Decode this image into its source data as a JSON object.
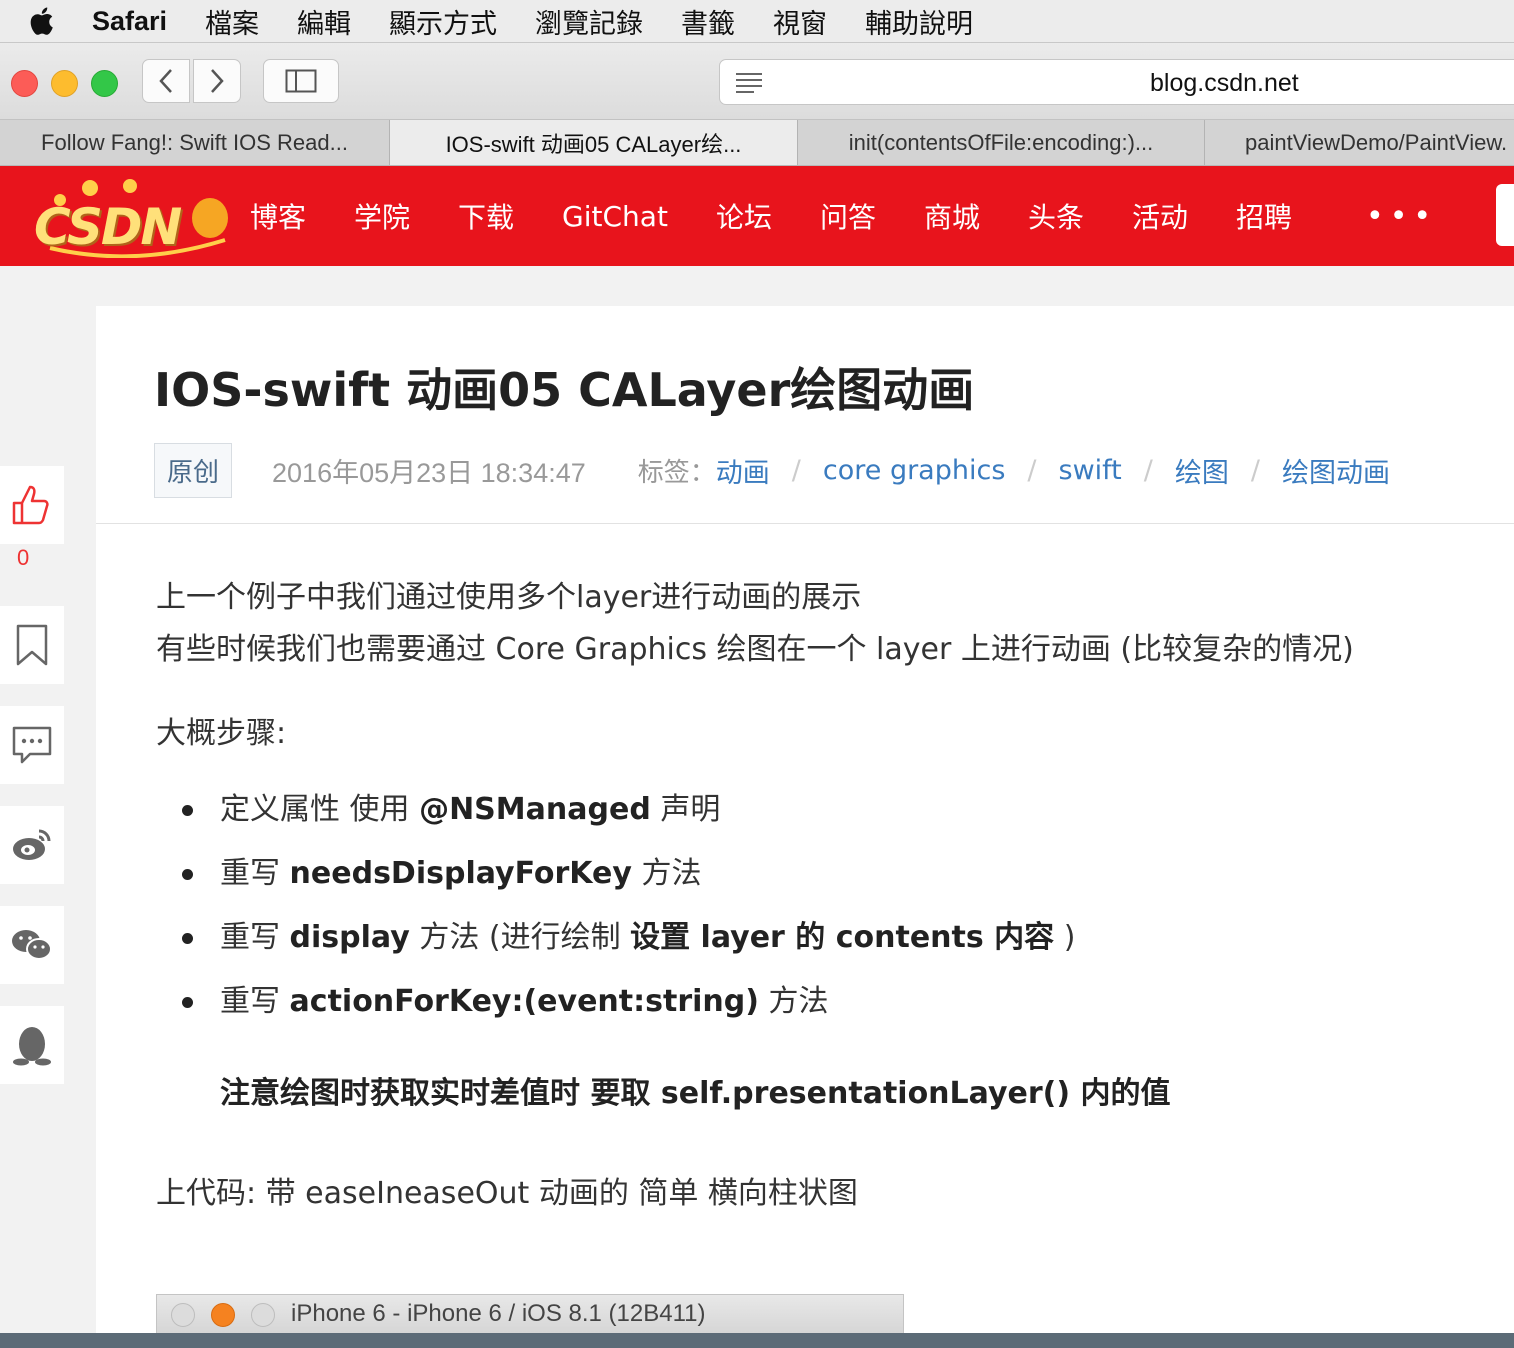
{
  "menubar": {
    "app_name": "Safari",
    "items": [
      "檔案",
      "編輯",
      "顯示方式",
      "瀏覽記錄",
      "書籤",
      "視窗",
      "輔助說明"
    ]
  },
  "toolbar": {
    "url": "blog.csdn.net"
  },
  "tabs": [
    {
      "label": "Follow Fang!: Swift IOS Read..."
    },
    {
      "label": "IOS-swift 动画05 CALayer绘..."
    },
    {
      "label": "init(contentsOfFile:encoding:)..."
    },
    {
      "label": "paintViewDemo/PaintView."
    }
  ],
  "csdn": {
    "logo_text": "CSDN",
    "nav": [
      "博客",
      "学院",
      "下载",
      "GitChat",
      "论坛",
      "问答",
      "商城",
      "头条",
      "活动",
      "招聘"
    ],
    "more": "•••",
    "brand_color": "#e8141c"
  },
  "rail": {
    "like_count": "0"
  },
  "article": {
    "title": "IOS-swift 动画05 CALayer绘图动画",
    "badge": "原创",
    "date": "2016年05月23日 18:34:47",
    "tags_label": "标签：",
    "tags": [
      "动画",
      "core graphics",
      "swift",
      "绘图",
      "绘图动画"
    ],
    "para1": "上一个例子中我们通过使用多个layer进行动画的展示",
    "para2": "有些时候我们也需要通过 Core Graphics 绘图在一个 layer 上进行动画 (比较复杂的情况)",
    "steps_heading": "大概步骤:",
    "bullets": [
      {
        "pre": "定义属性 使用 ",
        "bold": "@NSManaged",
        "post": " 声明"
      },
      {
        "pre": "重写 ",
        "bold": "needsDisplayForKey",
        "post": " 方法"
      },
      {
        "pre": "重写 ",
        "bold": "display",
        "post": " 方法 (进行绘制 ",
        "bold2": "设置 layer 的 contents 内容",
        "post2": " )"
      },
      {
        "pre": "重写 ",
        "bold": "actionForKey:(event:string)",
        "post": " 方法"
      }
    ],
    "note": "注意绘图时获取实时差值时 要取 self.presentationLayer() 内的值",
    "code_intro": "上代码: 带 easeIneaseOut 动画的 简单 横向柱状图",
    "simulator_title": "iPhone 6 - iPhone 6 / iOS 8.1 (12B411)"
  }
}
